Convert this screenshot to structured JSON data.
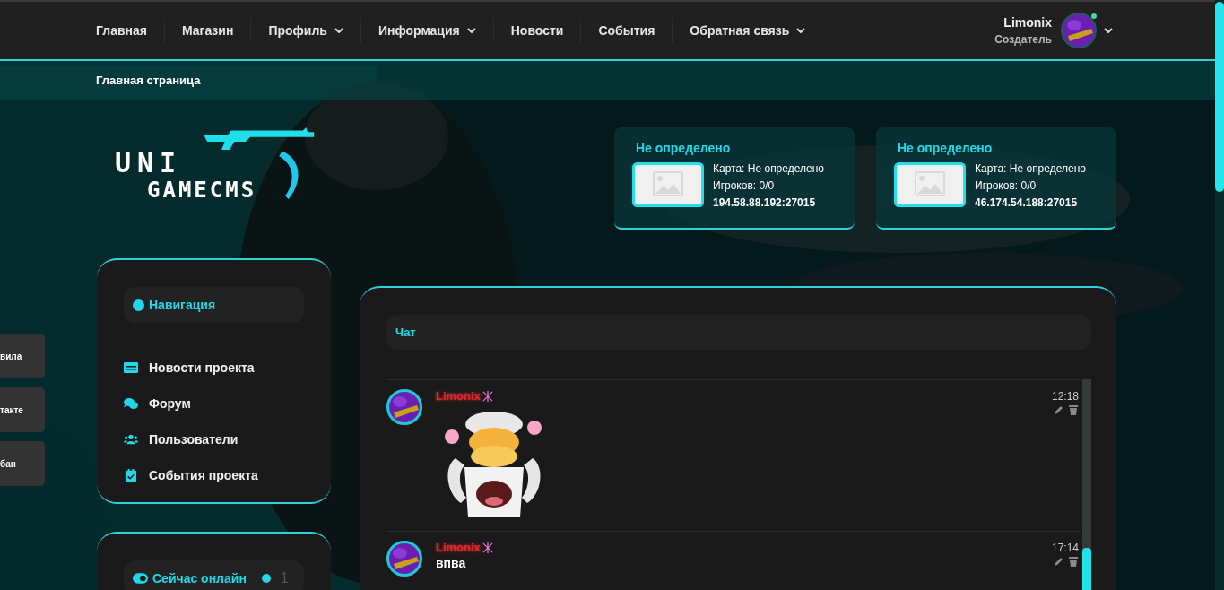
{
  "nav": {
    "items": [
      {
        "label": "Главная",
        "dropdown": false
      },
      {
        "label": "Магазин",
        "dropdown": false
      },
      {
        "label": "Профиль",
        "dropdown": true
      },
      {
        "label": "Информация",
        "dropdown": true
      },
      {
        "label": "Новости",
        "dropdown": false
      },
      {
        "label": "События",
        "dropdown": false
      },
      {
        "label": "Обратная связь",
        "dropdown": true
      }
    ]
  },
  "user": {
    "name": "Limonix",
    "role": "Создатель",
    "online": true
  },
  "breadcrumb": "Главная страница",
  "logo": {
    "line1": "UNI",
    "line2": "GAMECMS"
  },
  "servers": [
    {
      "name": "Не определено",
      "map": "Карта: Не определено",
      "players": "Игроков: 0/0",
      "address": "194.58.88.192:27015"
    },
    {
      "name": "Не определено",
      "map": "Карта: Не определено",
      "players": "Игроков: 0/0",
      "address": "46.174.54.188:27015"
    }
  ],
  "side_tabs": [
    "вила",
    "такте",
    "бан"
  ],
  "navigation": {
    "title": "Навигация",
    "items": [
      {
        "label": "Новости проекта",
        "kind": "news"
      },
      {
        "label": "Форум",
        "kind": "forum"
      },
      {
        "label": "Пользователи",
        "kind": "users"
      },
      {
        "label": "События проекта",
        "kind": "events"
      }
    ]
  },
  "online": {
    "title": "Сейчас онлайн",
    "count": "1"
  },
  "chat": {
    "title": "Чат",
    "messages": [
      {
        "author": "Limonix",
        "time": "12:18",
        "kind": "sticker"
      },
      {
        "author": "Limonix",
        "time": "17:14",
        "kind": "text",
        "text": "впва"
      }
    ]
  }
}
